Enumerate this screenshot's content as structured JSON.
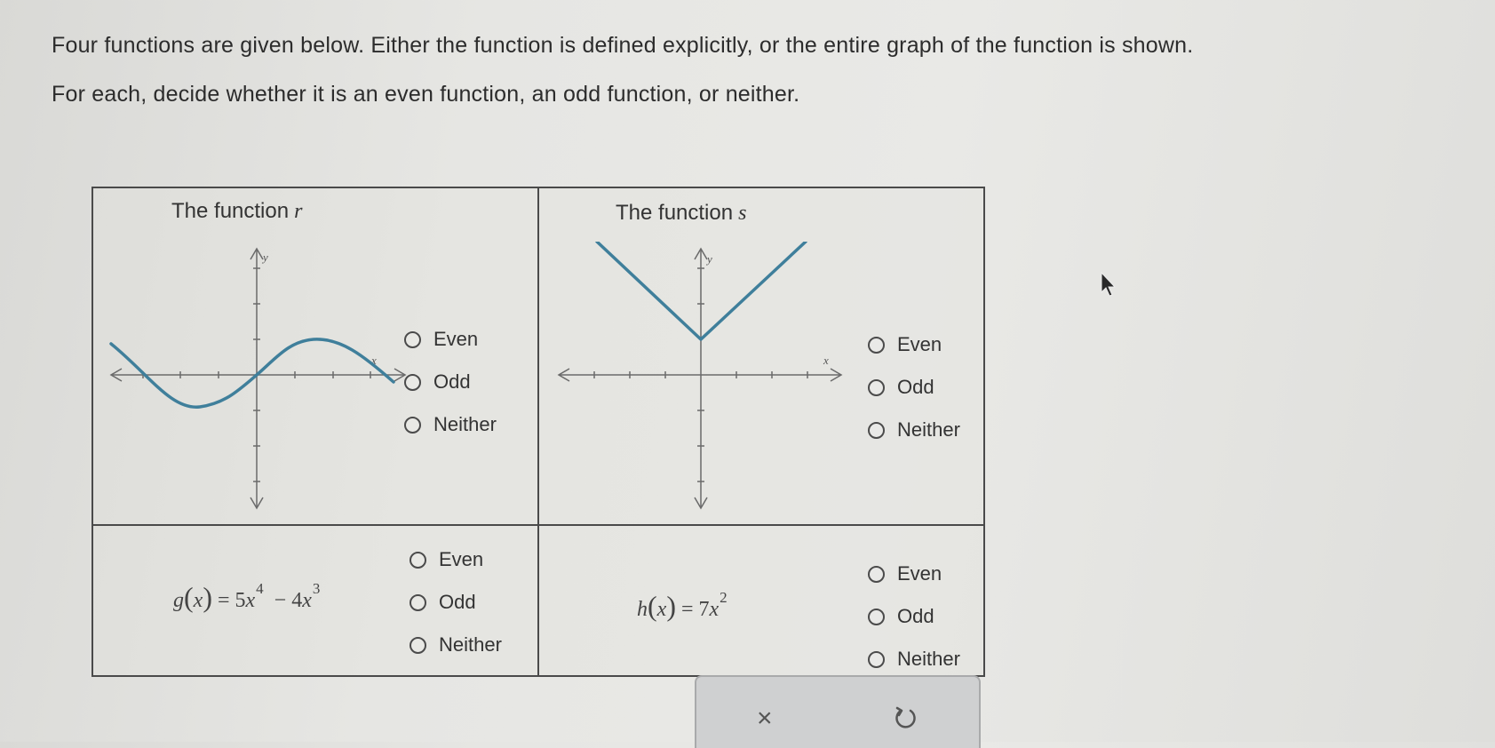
{
  "instructions": {
    "line1": "Four functions are given below. Either the function is defined explicitly, or the entire graph of the function is shown.",
    "line2": "For each, decide whether it is an even function, an odd function, or neither."
  },
  "cells": {
    "r": {
      "title_prefix": "The function",
      "var": "r",
      "axis_x": "x",
      "axis_y": "y",
      "options": [
        "Even",
        "Odd",
        "Neither"
      ]
    },
    "s": {
      "title_prefix": "The function",
      "var": "s",
      "axis_x": "x",
      "axis_y": "y",
      "options": [
        "Even",
        "Odd",
        "Neither"
      ]
    },
    "g": {
      "fname": "g",
      "arg": "x",
      "eq": "=",
      "coef1": "5",
      "var1": "x",
      "exp1": "4",
      "op": "−",
      "coef2": "4",
      "var2": "x",
      "exp2": "3",
      "options": [
        "Even",
        "Odd",
        "Neither"
      ]
    },
    "h": {
      "fname": "h",
      "arg": "x",
      "eq": "=",
      "coef1": "7",
      "var1": "x",
      "exp1": "2",
      "options": [
        "Even",
        "Odd",
        "Neither"
      ]
    }
  },
  "actions": {
    "clear_label": "×",
    "undo_icon": "undo-icon"
  },
  "colors": {
    "curve": "#3f7f9b",
    "axis": "#6a6a6a"
  }
}
